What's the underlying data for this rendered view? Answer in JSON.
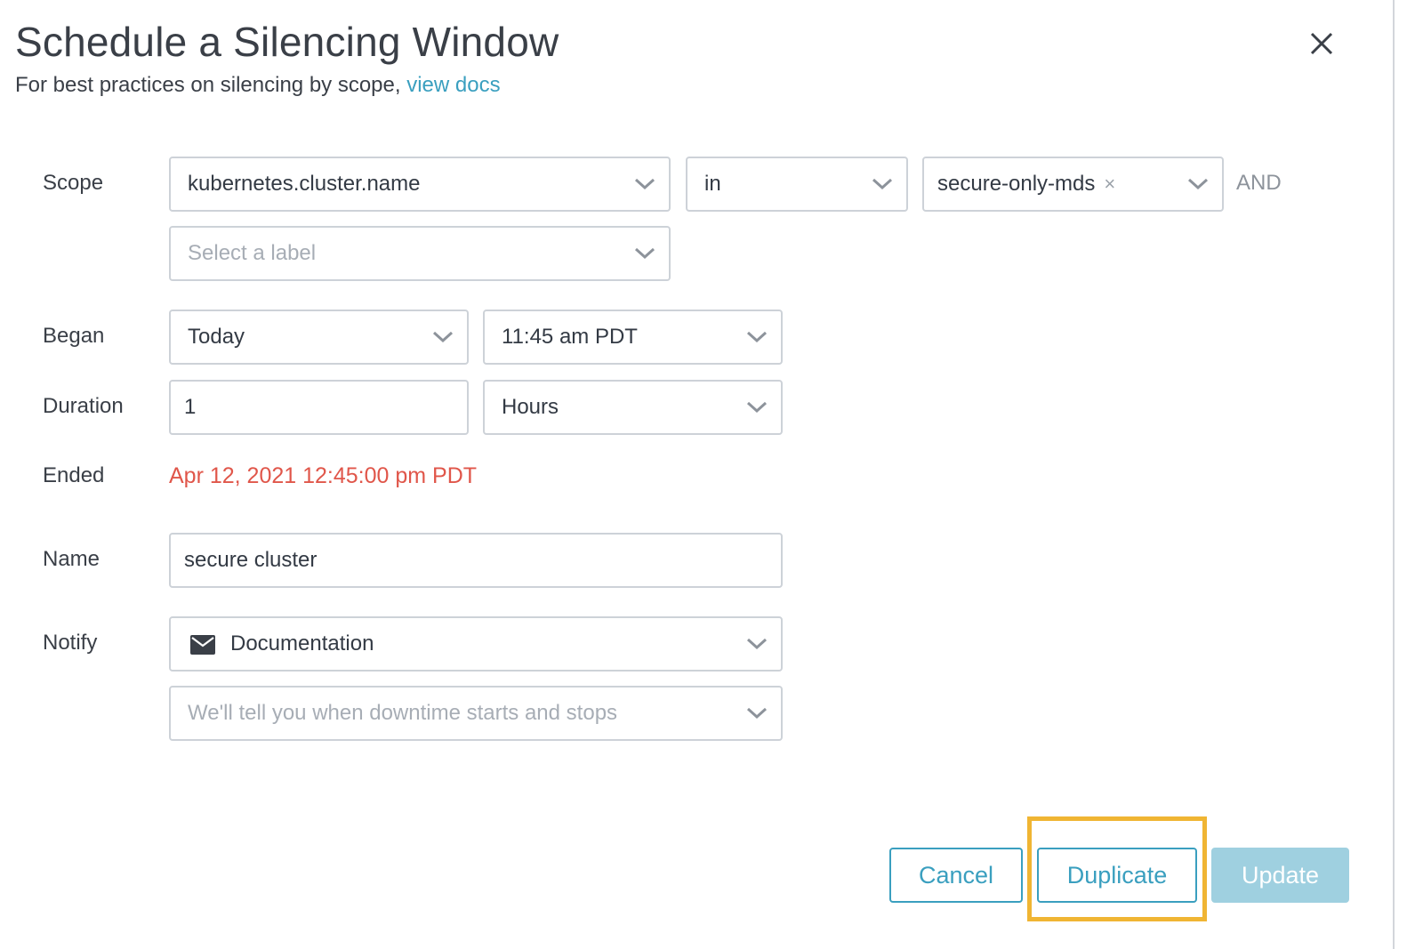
{
  "dialog": {
    "title": "Schedule a Silencing Window",
    "subtitle_prefix": "For best practices on silencing by scope, ",
    "subtitle_link": "view docs"
  },
  "form": {
    "scope": {
      "label": "Scope",
      "key_value": "kubernetes.cluster.name",
      "operator_value": "in",
      "value_tag": "secure-only-mds",
      "and_text": "AND",
      "add_label_placeholder": "Select a label"
    },
    "began": {
      "label": "Began",
      "date_value": "Today",
      "time_value": "11:45 am PDT"
    },
    "duration": {
      "label": "Duration",
      "amount_value": "1",
      "unit_value": "Hours"
    },
    "ended": {
      "label": "Ended",
      "value": "Apr 12, 2021 12:45:00 pm PDT"
    },
    "name": {
      "label": "Name",
      "value": "secure cluster"
    },
    "notify": {
      "label": "Notify",
      "channel_value": "Documentation",
      "add_channel_placeholder": "We'll tell you when downtime starts and stops"
    }
  },
  "buttons": {
    "cancel": "Cancel",
    "duplicate": "Duplicate",
    "update": "Update"
  },
  "colors": {
    "accent": "#3a9fbf",
    "error_text": "#e0564a",
    "highlight": "#f0b533",
    "update_disabled": "#9fd0e0"
  }
}
